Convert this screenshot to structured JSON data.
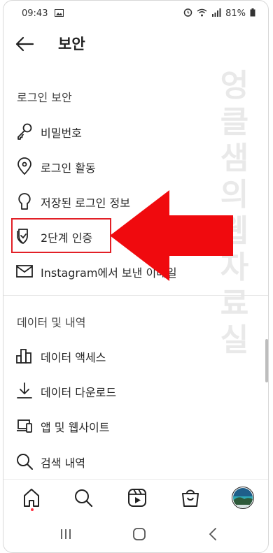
{
  "status_bar": {
    "time": "09:43",
    "battery": "81%"
  },
  "header": {
    "title": "보안"
  },
  "sections": {
    "login_security": {
      "title": "로그인 보안",
      "items": [
        {
          "label": "비밀번호",
          "icon": "key-icon"
        },
        {
          "label": "로그인 활동",
          "icon": "location-pin-icon"
        },
        {
          "label": "저장된 로그인 정보",
          "icon": "keyhole-icon"
        },
        {
          "label": "2단계 인증",
          "icon": "shield-check-icon"
        },
        {
          "label": "Instagram에서 보낸 이메일",
          "icon": "mail-icon"
        }
      ]
    },
    "data_history": {
      "title": "데이터 및 내역",
      "items": [
        {
          "label": "데이터 액세스",
          "icon": "bar-chart-icon"
        },
        {
          "label": "데이터 다운로드",
          "icon": "download-icon"
        },
        {
          "label": "앱 및 웹사이트",
          "icon": "devices-icon"
        },
        {
          "label": "검색 내역",
          "icon": "search-icon"
        }
      ]
    }
  },
  "annotation": {
    "color": "#e22027"
  },
  "watermark": {
    "text": "엉클샘의웹자료실"
  },
  "bottom_nav": [
    "home-icon",
    "search-icon",
    "reels-icon",
    "shop-icon",
    "profile-avatar"
  ]
}
